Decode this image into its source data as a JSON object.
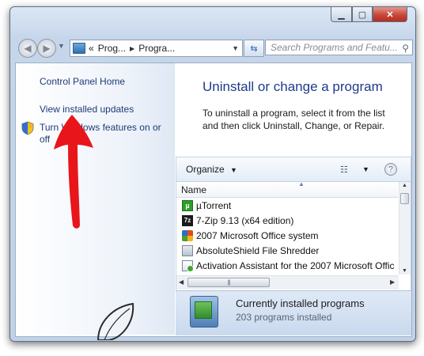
{
  "window": {
    "minimize_icon": "minimize-icon",
    "maximize_icon": "maximize-icon",
    "close_icon": "close-icon"
  },
  "nav": {
    "back_icon": "back-arrow-icon",
    "forward_icon": "forward-arrow-icon",
    "address": {
      "prefix": "«",
      "crumb1": "Prog...",
      "crumb2": "Progra..."
    },
    "search_placeholder": "Search Programs and Featu..."
  },
  "sidebar": {
    "links": [
      {
        "label": "Control Panel Home"
      },
      {
        "label": "View installed updates"
      },
      {
        "label": "Turn Windows features on or off"
      }
    ]
  },
  "main": {
    "title": "Uninstall or change a program",
    "description": "To uninstall a program, select it from the list and then click Uninstall, Change, or Repair."
  },
  "toolbar": {
    "organize_label": "Organize",
    "organize_arrow": "▼",
    "view_icon": "view-list-icon",
    "help_icon": "help-icon"
  },
  "list": {
    "column_header": "Name",
    "programs": [
      {
        "name": "µTorrent",
        "icon": "utorrent-icon"
      },
      {
        "name": "7-Zip 9.13 (x64 edition)",
        "icon": "7zip-icon"
      },
      {
        "name": "2007 Microsoft Office system",
        "icon": "office-icon"
      },
      {
        "name": "AbsoluteShield File Shredder",
        "icon": "shredder-icon"
      },
      {
        "name": "Activation Assistant for the 2007 Microsoft Offic",
        "icon": "activation-icon"
      }
    ]
  },
  "details": {
    "title": "Currently installed programs",
    "count": "203 programs installed"
  },
  "colors": {
    "link": "#1e3b78",
    "title": "#1e3b8c",
    "annotation_arrow": "#e8161b"
  }
}
